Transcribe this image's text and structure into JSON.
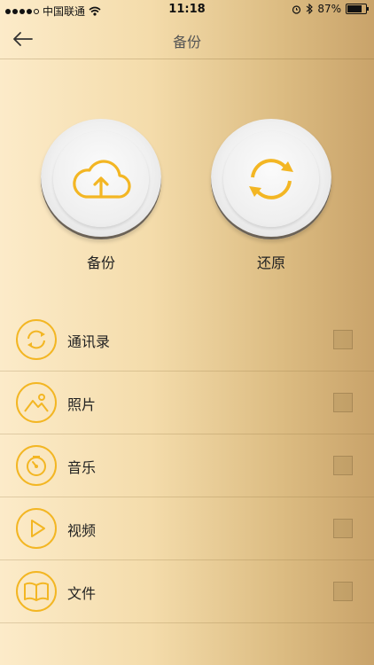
{
  "status": {
    "carrier": "中国联通",
    "time": "11:18",
    "battery": "87%",
    "battery_level": 0.87
  },
  "header": {
    "title": "备份"
  },
  "actions": {
    "backup_label": "备份",
    "restore_label": "还原"
  },
  "items": [
    {
      "label": "通讯录",
      "icon": "sync-icon"
    },
    {
      "label": "照片",
      "icon": "image-icon"
    },
    {
      "label": "音乐",
      "icon": "timer-icon"
    },
    {
      "label": "视频",
      "icon": "play-icon"
    },
    {
      "label": "文件",
      "icon": "book-icon"
    }
  ],
  "colors": {
    "accent": "#f3b623"
  }
}
